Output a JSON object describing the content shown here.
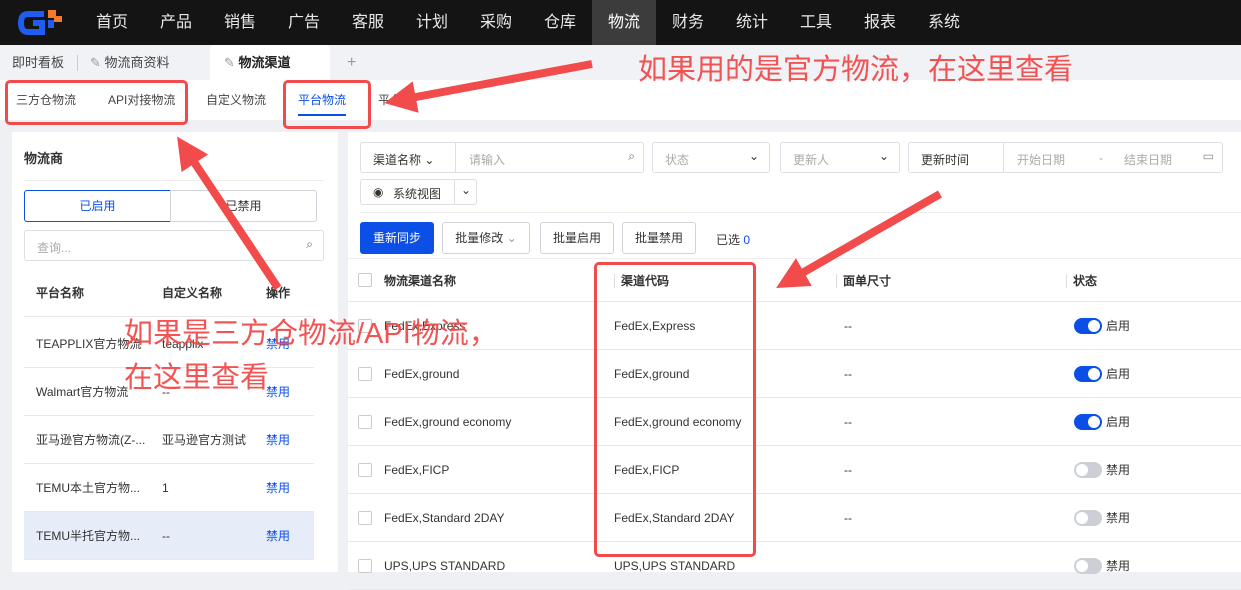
{
  "nav": {
    "items": [
      "首页",
      "产品",
      "销售",
      "广告",
      "客服",
      "计划",
      "采购",
      "仓库",
      "物流",
      "财务",
      "统计",
      "工具",
      "报表",
      "系统"
    ],
    "active": "物流"
  },
  "tabs": {
    "items": [
      "即时看板",
      "物流商资料",
      "物流渠道"
    ],
    "add": "+"
  },
  "subtabs": {
    "items": [
      "三方仓物流",
      "API对接物流",
      "自定义物流",
      "平台物流",
      "平台..."
    ],
    "active": "平台物流"
  },
  "left": {
    "title": "物流商",
    "seg_enabled": "已启用",
    "seg_disabled": "已禁用",
    "search_placeholder": "查询...",
    "headers": [
      "平台名称",
      "自定义名称",
      "操作"
    ],
    "rows": [
      {
        "name": "TEAPPLIX官方物流",
        "custom": "teapplix",
        "action": "禁用"
      },
      {
        "name": "Walmart官方物流",
        "custom": "--",
        "action": "禁用"
      },
      {
        "name": "亚马逊官方物流(Z-...",
        "custom": "亚马逊官方测试",
        "action": "禁用"
      },
      {
        "name": "TEMU本土官方物...",
        "custom": "1",
        "action": "禁用"
      },
      {
        "name": "TEMU半托官方物...",
        "custom": "--",
        "action": "禁用"
      }
    ]
  },
  "filters": {
    "field": "渠道名称",
    "input_placeholder": "请输入",
    "status": "状态",
    "updater": "更新人",
    "time": "更新时间",
    "start": "开始日期",
    "sep": "-",
    "end": "结束日期",
    "view": "系统视图"
  },
  "toolbar": {
    "resync": "重新同步",
    "batch_edit": "批量修改",
    "batch_enable": "批量启用",
    "batch_disable": "批量禁用",
    "selected_label": "已选",
    "selected_count": "0"
  },
  "table": {
    "headers": [
      "物流渠道名称",
      "渠道代码",
      "面单尺寸",
      "状态"
    ],
    "rows": [
      {
        "name": "FedEx,Express",
        "code": "FedEx,Express",
        "size": "--",
        "on": true,
        "status": "启用"
      },
      {
        "name": "FedEx,ground",
        "code": "FedEx,ground",
        "size": "--",
        "on": true,
        "status": "启用"
      },
      {
        "name": "FedEx,ground economy",
        "code": "FedEx,ground economy",
        "size": "--",
        "on": true,
        "status": "启用"
      },
      {
        "name": "FedEx,FICP",
        "code": "FedEx,FICP",
        "size": "--",
        "on": false,
        "status": "禁用"
      },
      {
        "name": "FedEx,Standard 2DAY",
        "code": "FedEx,Standard 2DAY",
        "size": "--",
        "on": false,
        "status": "禁用"
      },
      {
        "name": "UPS,UPS STANDARD",
        "code": "UPS,UPS STANDARD",
        "size": "",
        "on": false,
        "status": "禁用"
      }
    ]
  },
  "annotations": {
    "top": "如果用的是官方物流，在这里查看",
    "left_line1": "如果是三方仓物流/API物流，",
    "left_line2": "在这里查看"
  },
  "colors": {
    "accent": "#0b4fe6",
    "annotation": "#f24b4b",
    "nav_bg": "#141414"
  }
}
